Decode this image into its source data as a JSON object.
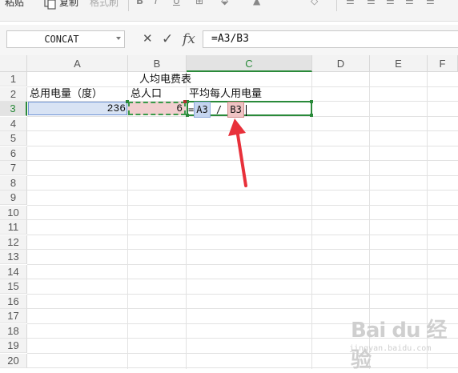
{
  "toolbar": {
    "paste_label": "粘贴",
    "copy_label": "复制",
    "format_painter_label": "格式刷"
  },
  "formula_bar": {
    "name_box": "CONCAT",
    "cancel_icon": "✕",
    "confirm_icon": "✓",
    "fx_label": "fx",
    "formula": "=A3/B3"
  },
  "columns": [
    "A",
    "B",
    "C",
    "D",
    "E",
    "F"
  ],
  "rows": [
    "1",
    "2",
    "3",
    "4",
    "5",
    "6",
    "7",
    "8",
    "9",
    "10",
    "11",
    "12",
    "13",
    "14",
    "15",
    "16",
    "17",
    "18",
    "19",
    "20"
  ],
  "cells": {
    "b1": "人均电费表",
    "a2": "总用电量（度）",
    "b2": "总人口",
    "c2": "平均每人用电量",
    "a3": "236",
    "b3": "6",
    "c3_prefix": "=",
    "c3_ref1": "A3",
    "c3_op": "/",
    "c3_ref2": "B3"
  },
  "annotation": {
    "color": "#e8303a"
  },
  "watermark": {
    "text": "Bai du 经验",
    "sub": "jingyan.baidu.com"
  },
  "colors": {
    "accent_green": "#2a8a3a",
    "ref_blue": "#c5d5f0",
    "ref_red": "#f0c4c4"
  }
}
